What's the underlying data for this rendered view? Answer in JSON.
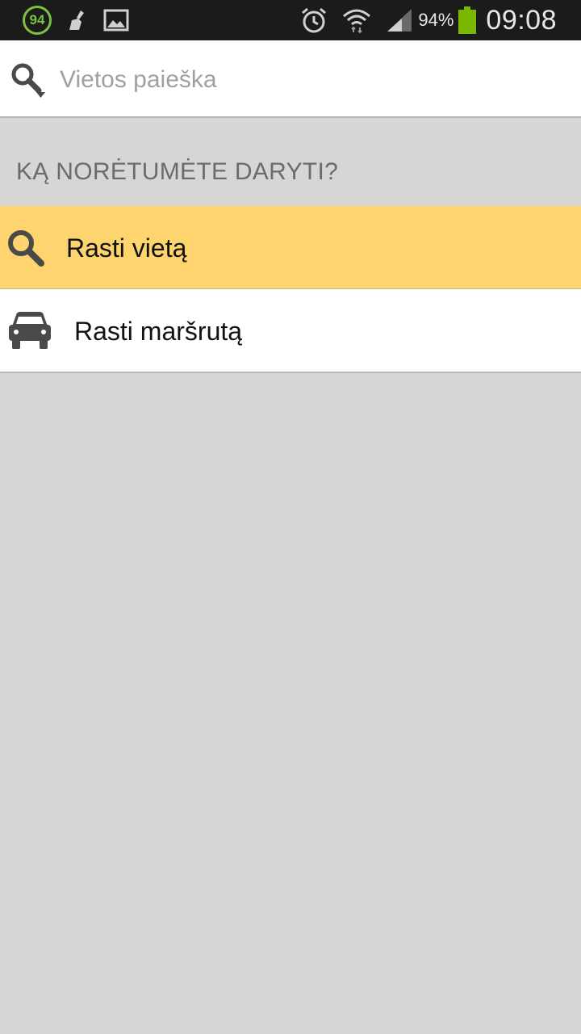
{
  "status_bar": {
    "notification_badge": "94",
    "battery_percent": "94%",
    "time": "09:08",
    "icons": [
      "badge-94-icon",
      "cleaner-broom-icon",
      "gallery-image-icon",
      "alarm-clock-icon",
      "wifi-icon",
      "signal-icon",
      "battery-icon"
    ],
    "battery_color": "#7ab800"
  },
  "search": {
    "placeholder": "Vietos paieška",
    "value": "",
    "icon": "search-dropdown-icon"
  },
  "section_header": "KĄ NORĖTUMĖTE DARYTI?",
  "menu": {
    "items": [
      {
        "label": "Rasti vietą",
        "icon": "search-icon",
        "highlighted": true
      },
      {
        "label": "Rasti maršrutą",
        "icon": "car-icon",
        "highlighted": false
      }
    ]
  },
  "colors": {
    "highlight": "#fdd46e",
    "background": "#d6d6d6",
    "status_bar": "#1b1b1b"
  }
}
